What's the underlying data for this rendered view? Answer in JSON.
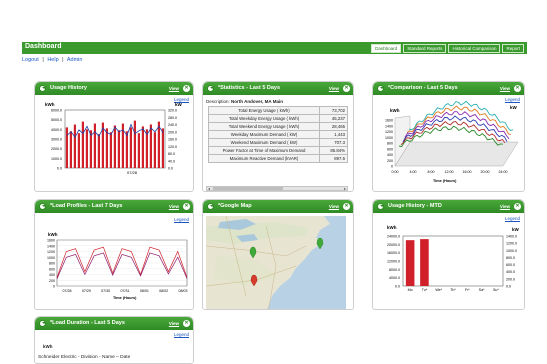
{
  "header": {
    "title": "Dashboard",
    "tabs": [
      {
        "label": "Dashboard"
      },
      {
        "label": "Standard Reports"
      },
      {
        "label": "Historical Comparison"
      },
      {
        "label": "Report"
      }
    ]
  },
  "links": {
    "logout": "Logout",
    "help": "Help",
    "admin": "Admin",
    "sep": "|"
  },
  "colors": {
    "header_green": "#3a9a2e",
    "bar_red": "#d0202a",
    "line_blue": "#1d3fa8"
  },
  "widgets": {
    "usage_history": {
      "title": "Usage History",
      "view": "View",
      "legend": "Legend",
      "ylabel_left": "kWh",
      "ylabel_right": "kW",
      "yticks_left": [
        "6000.0",
        "5000.0",
        "4000.0",
        "3000.0",
        "2000.0",
        "1000.0",
        "0.0"
      ],
      "yticks_right": [
        "320.0",
        "280.0",
        "240.0",
        "200.0",
        "160.0",
        "120.0",
        "80.0",
        "40.0",
        "0.0"
      ],
      "xtick": "07/28"
    },
    "statistics": {
      "title": "*Statistics - Last 5 Days",
      "view": "View",
      "desc_label": "Description:",
      "desc_value": "North Andover, MA Main",
      "rows": [
        {
          "label": "Total Energy Usage ( kWh)",
          "value": "73,702"
        },
        {
          "label": "Total Weekday Energy Usage ( kWh)",
          "value": "45,237"
        },
        {
          "label": "Total Weekend Energy Usage ( kWh)",
          "value": "28,465"
        },
        {
          "label": "Weekday Maximum Demand ( kW)",
          "value": "1,443"
        },
        {
          "label": "Weekend Maximum Demand ( kW)",
          "value": "707.3"
        },
        {
          "label": "Power Factor at Time of Maximum Demand",
          "value": "85.84%"
        },
        {
          "label": "Maximum Reactive Demand (kVAR)",
          "value": "897.6"
        }
      ]
    },
    "comparison": {
      "title": "*Comparison - Last 5 Days",
      "view": "View",
      "legend": "Legend",
      "ylabel_left": "kWh",
      "ylabel_right": "kW",
      "yticks": [
        "1600",
        "1400",
        "1200",
        "1000",
        "800",
        "600",
        "400",
        "200",
        "0"
      ],
      "xticks": [
        "0:00",
        "4:00",
        "8:00",
        "12:00",
        "16:00",
        "20:00",
        "24:00"
      ],
      "xlabel": "Time (Hours)"
    },
    "load_profiles": {
      "title": "*Load Profiles - Last 7 Days",
      "view": "View",
      "legend": "Legend",
      "ylabel": "kWh",
      "yticks": [
        "1600",
        "1400",
        "1200",
        "1000",
        "800",
        "600",
        "400",
        "200",
        "0"
      ],
      "xticks": [
        "07/28",
        "07/29",
        "07/30",
        "07/31",
        "08/01",
        "08/02",
        "08/03"
      ],
      "xlabel": "Time (Hours)"
    },
    "google_map": {
      "title": "*Google Map",
      "view": "View"
    },
    "usage_mtd": {
      "title": "Usage History - MTD",
      "view": "View",
      "legend": "Legend",
      "ylabel_left": "kWh",
      "ylabel_right": "kW",
      "yticks_left": [
        "24000.0",
        "20000.0",
        "16000.0",
        "12000.0",
        "8000.0",
        "4000.0",
        "0.0"
      ],
      "yticks_right": [
        "1400.0",
        "1200.0",
        "1000.0",
        "800.0",
        "600.0",
        "400.0",
        "200.0",
        "0.0"
      ],
      "xticks": [
        "Mo",
        "Tu*",
        "We*",
        "Th*",
        "Fr*",
        "Sa*",
        "Su*"
      ]
    },
    "load_duration": {
      "title": "*Load Duration - Last 5 Days",
      "view": "View",
      "legend": "Legend",
      "ylabel": "kWh",
      "caption": "Schneider Electric  - Division - Name – Date"
    }
  },
  "chart_data": [
    {
      "type": "bar",
      "title": "Usage History",
      "ylabel": "kWh",
      "ylim": [
        0,
        6000
      ],
      "values": [
        4200,
        3800,
        4500,
        3600,
        4800,
        4000,
        3900,
        4600,
        3500,
        4700,
        4100,
        3700,
        4400,
        3900,
        4600,
        3800,
        4200,
        4900,
        3600,
        4300,
        4000,
        4500,
        3700,
        4800,
        4100
      ],
      "series": [
        {
          "name": "kW",
          "type": "line",
          "values": [
            180,
            200,
            170,
            210,
            190,
            230,
            180,
            200,
            175,
            220,
            195,
            185,
            225,
            200,
            210,
            180,
            240,
            190,
            205,
            215,
            185,
            220,
            200,
            230,
            195
          ]
        }
      ]
    },
    {
      "type": "line",
      "title": "*Load Profiles - Last 7 Days",
      "ylabel": "kWh",
      "ylim": [
        0,
        1600
      ],
      "categories": [
        "07/28",
        "07/29",
        "07/30",
        "07/31",
        "08/01",
        "08/02",
        "08/03"
      ],
      "series": [
        {
          "values": [
            300,
            1200,
            1300,
            500,
            1250,
            1350,
            450,
            1300,
            1200,
            400,
            1350,
            1250,
            500,
            1200,
            300
          ]
        },
        {
          "values": [
            250,
            1000,
            1100,
            400,
            1050,
            1150,
            380,
            1100,
            1000,
            350,
            1150,
            1050,
            420,
            1000,
            260
          ]
        }
      ]
    },
    {
      "type": "bar",
      "title": "Usage History - MTD",
      "ylabel": "kWh",
      "ylim": [
        0,
        24000
      ],
      "categories": [
        "Mo",
        "Tu*",
        "We*",
        "Th*",
        "Fr*",
        "Sa*",
        "Su*"
      ],
      "values": [
        22000,
        22500,
        0,
        0,
        0,
        0,
        0
      ]
    }
  ]
}
